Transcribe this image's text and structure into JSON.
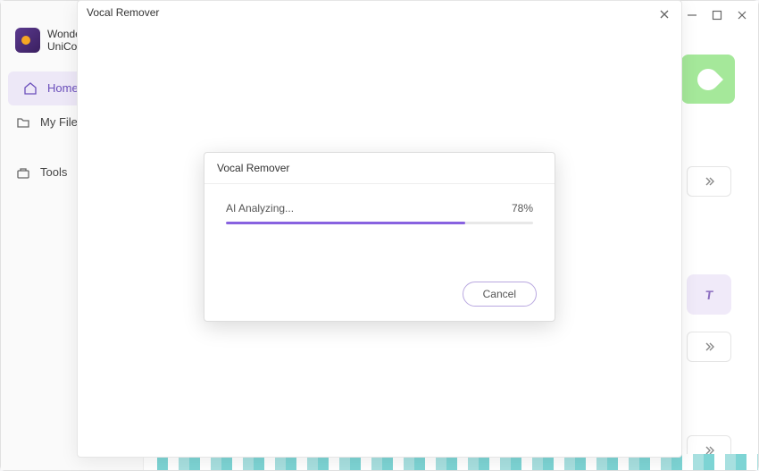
{
  "app": {
    "name_line1": "Wonder",
    "name_line2": "UniCon"
  },
  "sidebar": {
    "items": [
      {
        "label": "Home",
        "icon": "home"
      },
      {
        "label": "My File",
        "icon": "folder"
      },
      {
        "label": "Tools",
        "icon": "toolbox"
      }
    ]
  },
  "modal": {
    "title": "Vocal Remover"
  },
  "progress": {
    "title": "Vocal Remover",
    "status": "AI Analyzing...",
    "percent_text": "78%",
    "percent_value": 78,
    "cancel_label": "Cancel"
  }
}
